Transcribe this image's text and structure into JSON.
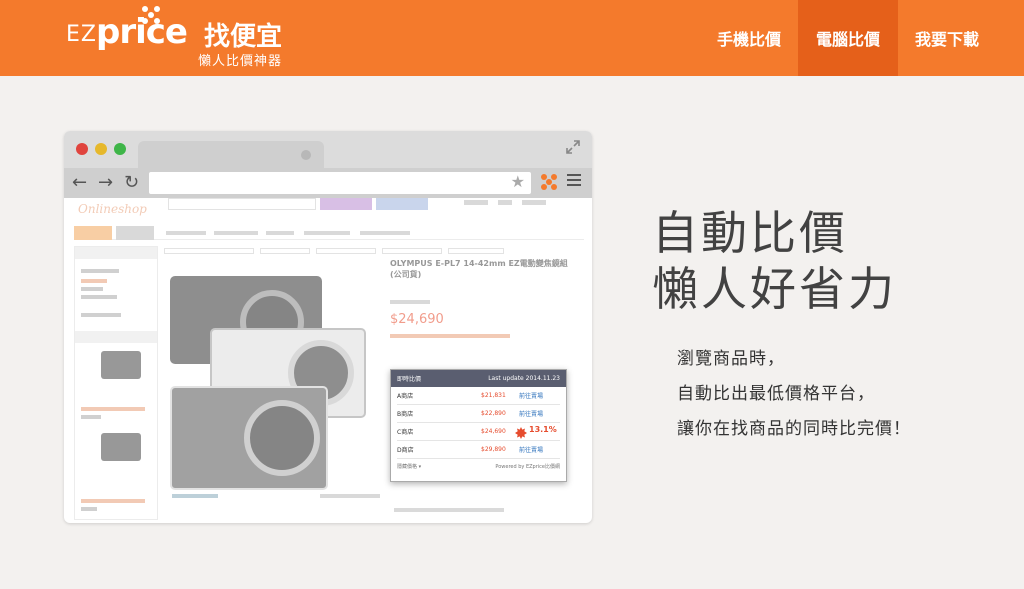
{
  "header": {
    "logo_ez": "EZ",
    "logo_price": "price",
    "logo_cn": "找便宜",
    "logo_sub": "懶人比價神器",
    "nav": [
      {
        "label": "手機比價",
        "active": false
      },
      {
        "label": "電腦比價",
        "active": true
      },
      {
        "label": "我要下載",
        "active": false
      }
    ]
  },
  "browser": {
    "shop_logo": "Onlineshop",
    "product_title": "OLYMPUS E-PL7 14-42mm EZ電動變焦鏡組 (公司貨)",
    "product_price": "$24,690",
    "popup": {
      "title": "即時比價",
      "last_update": "Last update 2014.11.23",
      "rows": [
        {
          "store": "A商店",
          "price": "$21,831",
          "action": "前往賣場"
        },
        {
          "store": "B商店",
          "price": "$22,890",
          "action": "前往賣場"
        },
        {
          "store": "C商店",
          "price": "$24,690",
          "action": "",
          "badge": "13.1%"
        },
        {
          "store": "D商店",
          "price": "$29,890",
          "action": "前往賣場"
        }
      ],
      "footer_left": "隱藏價格 ▾",
      "footer_right": "Powered by EZprice比價網"
    }
  },
  "hero": {
    "headline_1": "自動比價",
    "headline_2": "懶人好省力",
    "desc_1": "瀏覽商品時，",
    "desc_2": "自動比出最低價格平台，",
    "desc_3": "讓你在找商品的同時比完價！"
  },
  "colors": {
    "brand_orange": "#f47a2c",
    "nav_active": "#e5601a",
    "background": "#f3f1ef",
    "price_red": "#e64c2e"
  }
}
